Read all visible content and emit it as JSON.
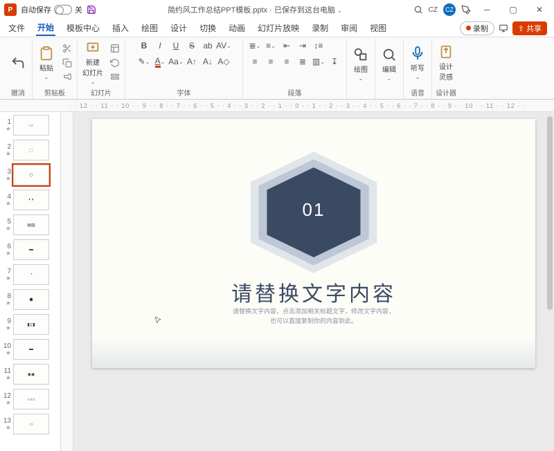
{
  "titlebar": {
    "autosave_label": "自动保存",
    "autosave_state": "关",
    "doc_title": "简约风工作总结PPT模板.pptx · 已保存到这台电脑",
    "user_initials_text": "CZ",
    "user_initials_avatar": "CZ"
  },
  "tabs": {
    "items": [
      "文件",
      "开始",
      "模板中心",
      "插入",
      "绘图",
      "设计",
      "切换",
      "动画",
      "幻灯片放映",
      "录制",
      "审阅",
      "视图"
    ],
    "active_index": 1,
    "record_label": "录制",
    "share_label": "共享"
  },
  "ribbon": {
    "undo_label": "撤消",
    "clipboard_label": "剪贴板",
    "paste_label": "粘贴",
    "slides_label": "幻灯片",
    "new_slide_label": "新建\n幻灯片",
    "font_label": "字体",
    "paragraph_label": "段落",
    "drawing_label": "绘图",
    "editing_label": "编辑",
    "voice_label": "语音",
    "dictate_label": "听写",
    "designer_label": "设计器",
    "design_ideas_label": "设计\n灵感"
  },
  "ruler_text": "· · 12 · · 11 · · 10 · · 9 · · 8 · · 7 · · 6 · · 5 · · 4 · · 3 · · 2 · · 1 · · 0 · · 1 · · 2 · · 3 · · 4 · · 5 · · 6 · · 7 · · 8 · · 9 · · 10 · · 11 · · 12 · ·",
  "thumbs": {
    "count": 13,
    "selected": 3
  },
  "slide": {
    "section_number": "01",
    "title": "请替换文字内容",
    "subtitle_line1": "请替换文字内容，点击添加相关标题文字，修改文字内容，",
    "subtitle_line2": "也可以直接复制你的内容到此。"
  }
}
